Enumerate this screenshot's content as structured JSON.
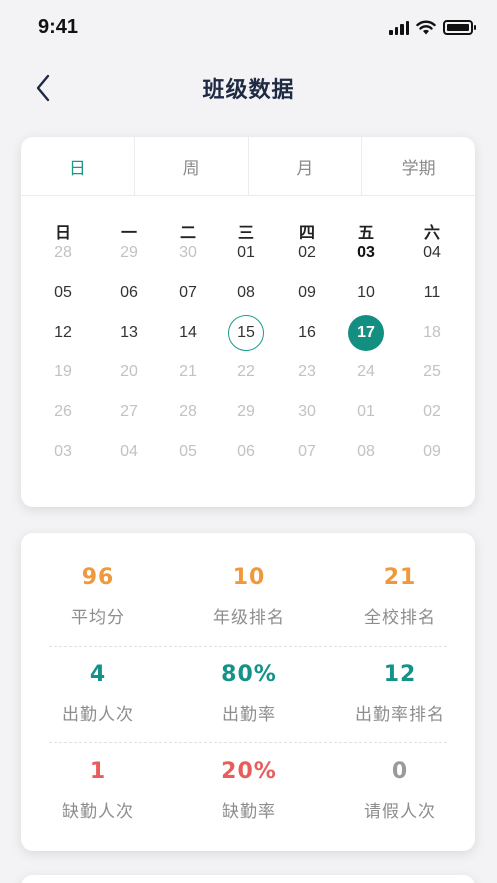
{
  "status_bar": {
    "time": "9:41"
  },
  "nav": {
    "title": "班级数据"
  },
  "tabs": [
    {
      "label": "日",
      "active": true
    },
    {
      "label": "周",
      "active": false
    },
    {
      "label": "月",
      "active": false
    },
    {
      "label": "学期",
      "active": false
    }
  ],
  "calendar": {
    "weekdays": [
      "日",
      "一",
      "二",
      "三",
      "四",
      "五",
      "六"
    ],
    "weeks": [
      [
        {
          "t": "28",
          "s": "muted"
        },
        {
          "t": "29",
          "s": "muted"
        },
        {
          "t": "30",
          "s": "muted"
        },
        {
          "t": "01",
          "s": ""
        },
        {
          "t": "02",
          "s": ""
        },
        {
          "t": "03",
          "s": "bold"
        },
        {
          "t": "04",
          "s": ""
        }
      ],
      [
        {
          "t": "05",
          "s": ""
        },
        {
          "t": "06",
          "s": ""
        },
        {
          "t": "07",
          "s": ""
        },
        {
          "t": "08",
          "s": ""
        },
        {
          "t": "09",
          "s": ""
        },
        {
          "t": "10",
          "s": ""
        },
        {
          "t": "11",
          "s": ""
        }
      ],
      [
        {
          "t": "12",
          "s": ""
        },
        {
          "t": "13",
          "s": ""
        },
        {
          "t": "14",
          "s": ""
        },
        {
          "t": "15",
          "s": "ring"
        },
        {
          "t": "16",
          "s": ""
        },
        {
          "t": "17",
          "s": "filled"
        },
        {
          "t": "18",
          "s": "muted"
        }
      ],
      [
        {
          "t": "19",
          "s": "muted"
        },
        {
          "t": "20",
          "s": "muted"
        },
        {
          "t": "21",
          "s": "muted"
        },
        {
          "t": "22",
          "s": "muted"
        },
        {
          "t": "23",
          "s": "muted"
        },
        {
          "t": "24",
          "s": "muted"
        },
        {
          "t": "25",
          "s": "muted"
        }
      ],
      [
        {
          "t": "26",
          "s": "muted"
        },
        {
          "t": "27",
          "s": "muted"
        },
        {
          "t": "28",
          "s": "muted"
        },
        {
          "t": "29",
          "s": "muted"
        },
        {
          "t": "30",
          "s": "muted"
        },
        {
          "t": "01",
          "s": "muted"
        },
        {
          "t": "02",
          "s": "muted"
        }
      ],
      [
        {
          "t": "03",
          "s": "muted"
        },
        {
          "t": "04",
          "s": "muted"
        },
        {
          "t": "05",
          "s": "muted"
        },
        {
          "t": "06",
          "s": "muted"
        },
        {
          "t": "07",
          "s": "muted"
        },
        {
          "t": "08",
          "s": "muted"
        },
        {
          "t": "09",
          "s": "muted"
        }
      ]
    ]
  },
  "stats": {
    "r1": {
      "a": {
        "value": "96",
        "label": "平均分"
      },
      "b": {
        "value": "10",
        "label": "年级排名"
      },
      "c": {
        "value": "21",
        "label": "全校排名"
      }
    },
    "r2": {
      "a": {
        "value": "4",
        "label": "出勤人次"
      },
      "b": {
        "value": "80%",
        "label": "出勤率"
      },
      "c": {
        "value": "12",
        "label": "出勤率排名"
      }
    },
    "r3": {
      "a": {
        "value": "1",
        "label": "缺勤人次"
      },
      "b": {
        "value": "20%",
        "label": "缺勤率"
      },
      "c": {
        "value": "0",
        "label": "请假人次"
      }
    }
  },
  "colors": {
    "accent": "#13928a",
    "orange": "#f0983c",
    "red": "#e95c5c",
    "muted": "#9a9a9a"
  }
}
